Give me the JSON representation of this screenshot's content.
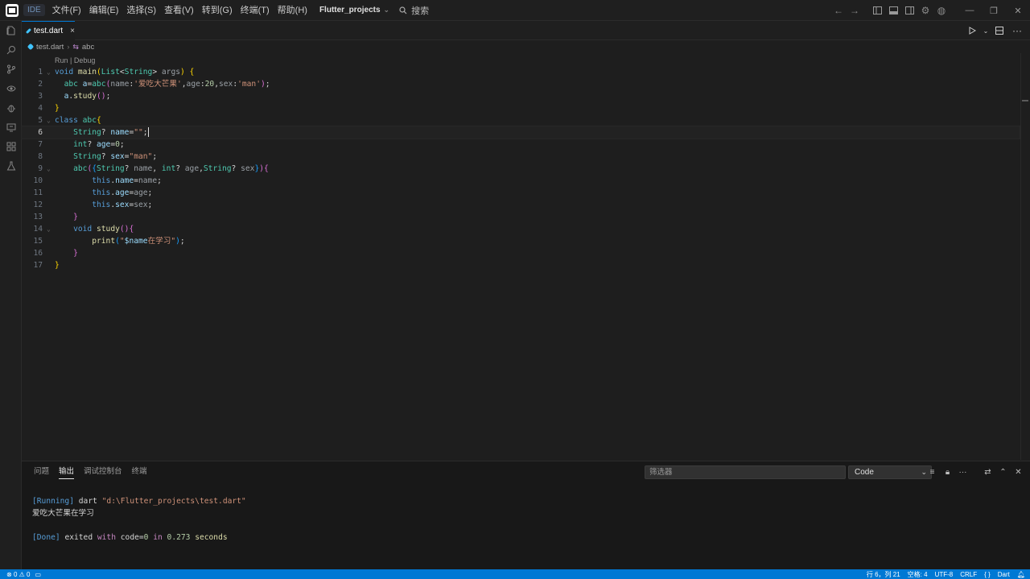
{
  "titlebar": {
    "ide_badge": "IDE",
    "menu": [
      "文件(F)",
      "编辑(E)",
      "选择(S)",
      "查看(V)",
      "转到(G)",
      "终端(T)",
      "帮助(H)"
    ],
    "project": "Flutter_projects",
    "search": "搜索"
  },
  "tab": {
    "label": "test.dart",
    "close": "×"
  },
  "breadcrumb": {
    "file": "test.dart",
    "symbol": "abc"
  },
  "codelens": "Run | Debug",
  "code_lines": [
    {
      "n": "1",
      "fold": true,
      "tokens": [
        [
          "void ",
          "t-kw"
        ],
        [
          "main",
          "t-fn"
        ],
        [
          "(",
          "t-b1"
        ],
        [
          "List",
          "t-ty"
        ],
        [
          "<",
          "t-plain"
        ],
        [
          "String",
          "t-ty"
        ],
        [
          "> ",
          "t-plain"
        ],
        [
          "args",
          "t-param"
        ],
        [
          ") {",
          "t-b1"
        ]
      ]
    },
    {
      "n": "2",
      "tokens": [
        [
          "  ",
          "t-plain"
        ],
        [
          "abc ",
          "t-ty"
        ],
        [
          "a",
          "t-var"
        ],
        [
          "=",
          "t-plain"
        ],
        [
          "abc",
          "t-ty"
        ],
        [
          "(",
          "t-b2"
        ],
        [
          "name",
          "t-param"
        ],
        [
          ":",
          "t-plain"
        ],
        [
          "'爱吃大芒果'",
          "t-str"
        ],
        [
          ",",
          "t-plain"
        ],
        [
          "age",
          "t-param"
        ],
        [
          ":",
          "t-plain"
        ],
        [
          "20",
          "t-num"
        ],
        [
          ",",
          "t-plain"
        ],
        [
          "sex",
          "t-param"
        ],
        [
          ":",
          "t-plain"
        ],
        [
          "'man'",
          "t-str"
        ],
        [
          ")",
          "t-b2"
        ],
        [
          ";",
          "t-plain"
        ]
      ]
    },
    {
      "n": "3",
      "tokens": [
        [
          "  ",
          "t-plain"
        ],
        [
          "a",
          "t-var"
        ],
        [
          ".",
          "t-plain"
        ],
        [
          "study",
          "t-fn"
        ],
        [
          "()",
          "t-b2"
        ],
        [
          ";",
          "t-plain"
        ]
      ]
    },
    {
      "n": "4",
      "tokens": [
        [
          "}",
          "t-b1"
        ]
      ]
    },
    {
      "n": "5",
      "fold": true,
      "tokens": [
        [
          "class ",
          "t-kw"
        ],
        [
          "abc",
          "t-ty"
        ],
        [
          "{",
          "t-b1"
        ]
      ]
    },
    {
      "n": "6",
      "current": true,
      "tokens": [
        [
          "    ",
          "t-plain"
        ],
        [
          "String",
          "t-ty"
        ],
        [
          "? ",
          "t-plain"
        ],
        [
          "name",
          "t-var"
        ],
        [
          "=",
          "t-plain"
        ],
        [
          "\"\"",
          "t-str"
        ],
        [
          ";",
          "t-plain"
        ]
      ]
    },
    {
      "n": "7",
      "tokens": [
        [
          "    ",
          "t-plain"
        ],
        [
          "int",
          "t-ty"
        ],
        [
          "? ",
          "t-plain"
        ],
        [
          "age",
          "t-var"
        ],
        [
          "=",
          "t-plain"
        ],
        [
          "0",
          "t-num"
        ],
        [
          ";",
          "t-plain"
        ]
      ]
    },
    {
      "n": "8",
      "tokens": [
        [
          "    ",
          "t-plain"
        ],
        [
          "String",
          "t-ty"
        ],
        [
          "? ",
          "t-plain"
        ],
        [
          "sex",
          "t-var"
        ],
        [
          "=",
          "t-plain"
        ],
        [
          "\"man\"",
          "t-str"
        ],
        [
          ";",
          "t-plain"
        ]
      ]
    },
    {
      "n": "9",
      "fold": true,
      "tokens": [
        [
          "    ",
          "t-plain"
        ],
        [
          "abc",
          "t-ty"
        ],
        [
          "(",
          "t-b2"
        ],
        [
          "{",
          "t-b3"
        ],
        [
          "String",
          "t-ty"
        ],
        [
          "? ",
          "t-plain"
        ],
        [
          "name",
          "t-param"
        ],
        [
          ", ",
          "t-plain"
        ],
        [
          "int",
          "t-ty"
        ],
        [
          "? ",
          "t-plain"
        ],
        [
          "age",
          "t-param"
        ],
        [
          ",",
          "t-plain"
        ],
        [
          "String",
          "t-ty"
        ],
        [
          "? ",
          "t-plain"
        ],
        [
          "sex",
          "t-param"
        ],
        [
          "}",
          "t-b3"
        ],
        [
          ")",
          "t-b2"
        ],
        [
          "{",
          "t-b2"
        ]
      ]
    },
    {
      "n": "10",
      "tokens": [
        [
          "        ",
          "t-plain"
        ],
        [
          "this",
          "t-this"
        ],
        [
          ".",
          "t-plain"
        ],
        [
          "name",
          "t-var"
        ],
        [
          "=",
          "t-plain"
        ],
        [
          "name",
          "t-param"
        ],
        [
          ";",
          "t-plain"
        ]
      ]
    },
    {
      "n": "11",
      "tokens": [
        [
          "        ",
          "t-plain"
        ],
        [
          "this",
          "t-this"
        ],
        [
          ".",
          "t-plain"
        ],
        [
          "age",
          "t-var"
        ],
        [
          "=",
          "t-plain"
        ],
        [
          "age",
          "t-param"
        ],
        [
          ";",
          "t-plain"
        ]
      ]
    },
    {
      "n": "12",
      "tokens": [
        [
          "        ",
          "t-plain"
        ],
        [
          "this",
          "t-this"
        ],
        [
          ".",
          "t-plain"
        ],
        [
          "sex",
          "t-var"
        ],
        [
          "=",
          "t-plain"
        ],
        [
          "sex",
          "t-param"
        ],
        [
          ";",
          "t-plain"
        ]
      ]
    },
    {
      "n": "13",
      "tokens": [
        [
          "    ",
          "t-plain"
        ],
        [
          "}",
          "t-b2"
        ]
      ]
    },
    {
      "n": "14",
      "fold": true,
      "tokens": [
        [
          "    ",
          "t-plain"
        ],
        [
          "void ",
          "t-kw"
        ],
        [
          "study",
          "t-fn"
        ],
        [
          "()",
          "t-b2"
        ],
        [
          "{",
          "t-b2"
        ]
      ]
    },
    {
      "n": "15",
      "tokens": [
        [
          "        ",
          "t-plain"
        ],
        [
          "print",
          "t-fn"
        ],
        [
          "(",
          "t-b3"
        ],
        [
          "\"",
          "t-str"
        ],
        [
          "$name",
          "t-var"
        ],
        [
          "在学习\"",
          "t-str"
        ],
        [
          ")",
          "t-b3"
        ],
        [
          ";",
          "t-plain"
        ]
      ]
    },
    {
      "n": "16",
      "tokens": [
        [
          "    ",
          "t-plain"
        ],
        [
          "}",
          "t-b2"
        ]
      ]
    },
    {
      "n": "17",
      "tokens": [
        [
          "}",
          "t-b1"
        ]
      ]
    }
  ],
  "panel": {
    "tabs": [
      "问题",
      "输出",
      "调试控制台",
      "终端"
    ],
    "active_tab": "输出",
    "filter_placeholder": "筛选器",
    "select_value": "Code",
    "output_lines": [
      [
        [
          "[Running] ",
          "o-tag"
        ],
        [
          "dart ",
          "o-plain"
        ],
        [
          "\"d:\\Flutter_projects\\test.dart\"",
          "o-str"
        ]
      ],
      [
        [
          "爱吃大芒果在学习",
          "o-plain"
        ]
      ],
      [
        [
          "",
          "o-plain"
        ]
      ],
      [
        [
          "[Done] ",
          "o-tag"
        ],
        [
          "exited ",
          "o-plain"
        ],
        [
          "with ",
          "o-kw"
        ],
        [
          "code",
          "o-plain"
        ],
        [
          "=",
          "o-plain"
        ],
        [
          "0 ",
          "o-num"
        ],
        [
          "in ",
          "o-kw"
        ],
        [
          "0.273 ",
          "o-num"
        ],
        [
          "seconds",
          "o-fn"
        ]
      ]
    ]
  },
  "statusbar": {
    "errors": "0",
    "warnings": "0",
    "position": "行 6，列 21",
    "spaces": "空格: 4",
    "encoding": "UTF-8",
    "eol": "CRLF",
    "braces": "{ }",
    "language": "Dart"
  },
  "colors": {
    "accent": "#0078d4",
    "editor_bg": "#1e1e1e"
  }
}
